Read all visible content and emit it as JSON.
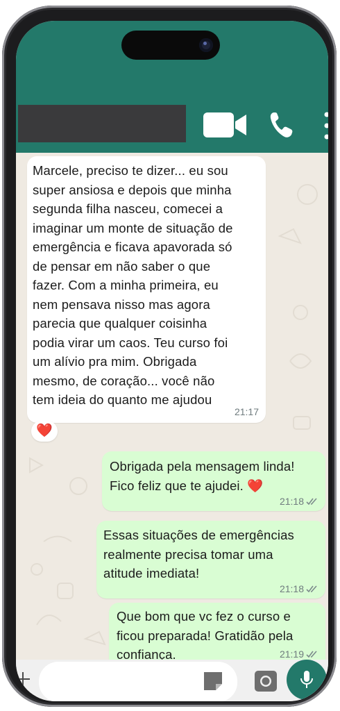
{
  "header": {
    "contact_name": "",
    "icons": [
      "video-call-icon",
      "phone-call-icon",
      "more-options-icon"
    ]
  },
  "messages": [
    {
      "direction": "incoming",
      "lines": [
        "Marcele, preciso te dizer... eu sou",
        "super ansiosa e depois que minha",
        "segunda filha nasceu, comecei a",
        "imaginar um monte de situação de",
        "emergência e ficava apavorada só",
        "de pensar em não saber o que",
        "fazer. Com a minha primeira, eu",
        "nem pensava nisso mas agora",
        "parecia que qualquer coisinha",
        "podia virar um caos. Teu curso foi",
        "um alívio pra mim. Obrigada",
        "mesmo, de coração... você não",
        "tem ideia do quanto me ajudou"
      ],
      "time": "21:17",
      "reaction": "❤️"
    },
    {
      "direction": "outgoing",
      "lines": [
        "Obrigada pela mensagem linda!",
        "Fico feliz que te ajudei. ❤️"
      ],
      "time": "21:18",
      "status": "read-ticks-icon"
    },
    {
      "direction": "outgoing",
      "lines": [
        "Essas situações de emergências",
        "realmente precisa tomar uma",
        "atitude imediata!"
      ],
      "time": "21:18",
      "status": "read-ticks-icon"
    },
    {
      "direction": "outgoing",
      "lines": [
        "Que bom que vc fez o curso e",
        "ficou preparada! Gratidão pela",
        "confiança."
      ],
      "time": "21:19",
      "status": "read-ticks-icon"
    }
  ],
  "composer": {
    "placeholder": "",
    "icons": [
      "plus-icon",
      "sticker-icon",
      "camera-icon",
      "microphone-icon"
    ]
  },
  "colors": {
    "header": "#23796a",
    "chat_background": "#efeae2",
    "incoming_bubble": "#ffffff",
    "outgoing_bubble": "#d9fdd3",
    "read_ticks": "#7c8a8c"
  }
}
